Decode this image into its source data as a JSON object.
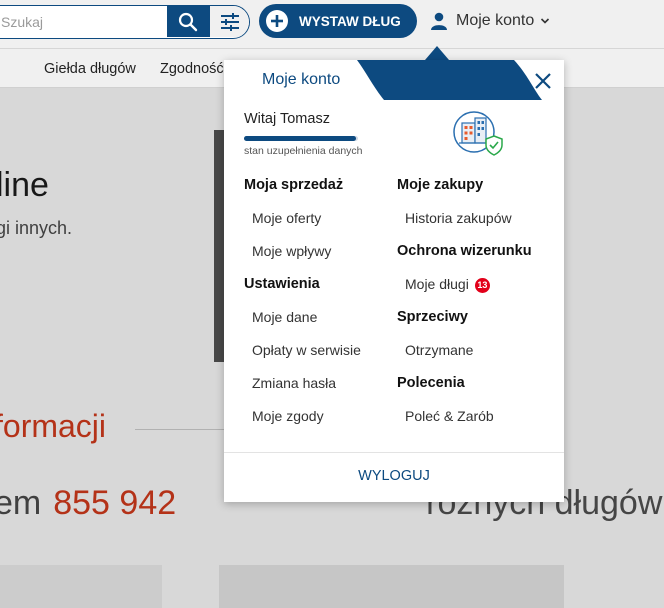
{
  "header": {
    "search": {
      "placeholder": "Szukaj",
      "value": ""
    },
    "cta_label": "WYSTAW DŁUG",
    "account_label": "Moje konto"
  },
  "nav": {
    "items": [
      "Giełda długów",
      "Zgodność"
    ]
  },
  "background": {
    "title_fragment": "line",
    "subtitle_fragment": "gi innych.",
    "section_fragment": "formacji",
    "stats_prefix": "em",
    "stats_number": "855 942",
    "stats_suffix": "różnych długów"
  },
  "menu": {
    "title": "Moje konto",
    "greeting": "Witaj Tomasz",
    "progress": {
      "fraction": 0.98,
      "label": "stan uzupełnienia danych"
    },
    "left_column": [
      {
        "heading": "Moja sprzedaż",
        "links": [
          "Moje oferty",
          "Moje wpływy"
        ]
      },
      {
        "heading": "Ustawienia",
        "links": [
          "Moje dane",
          "Opłaty w serwisie",
          "Zmiana hasła",
          "Moje zgody"
        ]
      }
    ],
    "right_column": [
      {
        "heading": "Moje zakupy",
        "links": [
          "Historia zakupów"
        ]
      },
      {
        "heading": "Ochrona wizerunku",
        "links": [
          "Moje długi"
        ],
        "badge": "13"
      },
      {
        "heading": "Sprzeciwy",
        "links": [
          "Otrzymane"
        ]
      },
      {
        "heading": "Polecenia",
        "links": [
          "Poleć & Zarób"
        ]
      }
    ],
    "logout_label": "WYLOGUJ"
  },
  "colors": {
    "brand": "#0d4a80",
    "accent": "#c0361a",
    "badge": "#e2001a"
  },
  "icons": [
    "search-icon",
    "filter-icon",
    "plus-circle-icon",
    "user-icon",
    "chevron-down-icon",
    "close-icon",
    "building-shield-icon"
  ]
}
